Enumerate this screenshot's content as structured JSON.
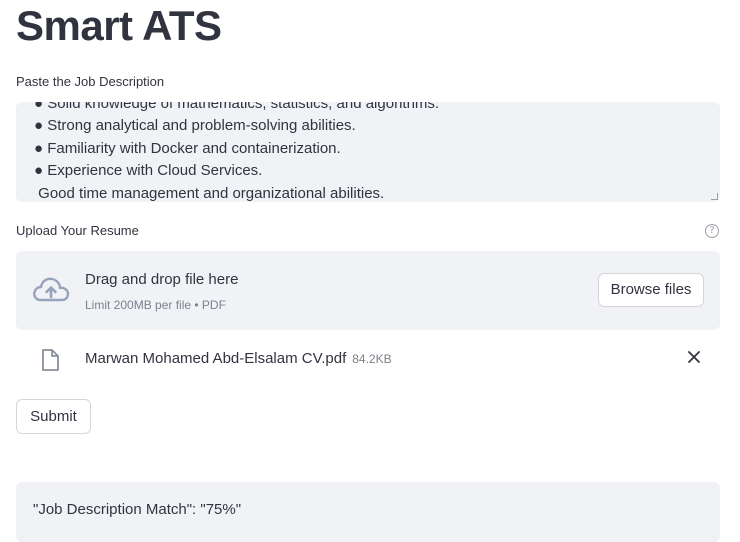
{
  "app": {
    "title": "Smart ATS"
  },
  "job_description": {
    "label": "Paste the Job Description",
    "lines": [
      "● Solid knowledge of mathematics, statistics, and algorithms.",
      "● Strong analytical and problem-solving abilities.",
      "● Familiarity with Docker and containerization.",
      "● Experience with Cloud Services.",
      " Good time management and organizational abilities."
    ]
  },
  "resume_upload": {
    "label": "Upload Your Resume",
    "help_icon": "question-circle-icon",
    "drop_title": "Drag and drop file here",
    "drop_subtitle": "Limit 200MB per file • PDF",
    "browse_label": "Browse files",
    "upload_icon": "cloud-upload-icon",
    "file": {
      "name": "Marwan Mohamed Abd-Elsalam CV.pdf",
      "size": "84.2KB",
      "icon": "file-icon",
      "remove_icon": "close-icon"
    }
  },
  "actions": {
    "submit_label": "Submit"
  },
  "result": {
    "text": "\"Job Description Match\": \"75%\""
  },
  "colors": {
    "text": "#31333f",
    "muted": "#7e818c",
    "panel_bg": "#f0f2f6",
    "border": "#d6d6d9"
  }
}
